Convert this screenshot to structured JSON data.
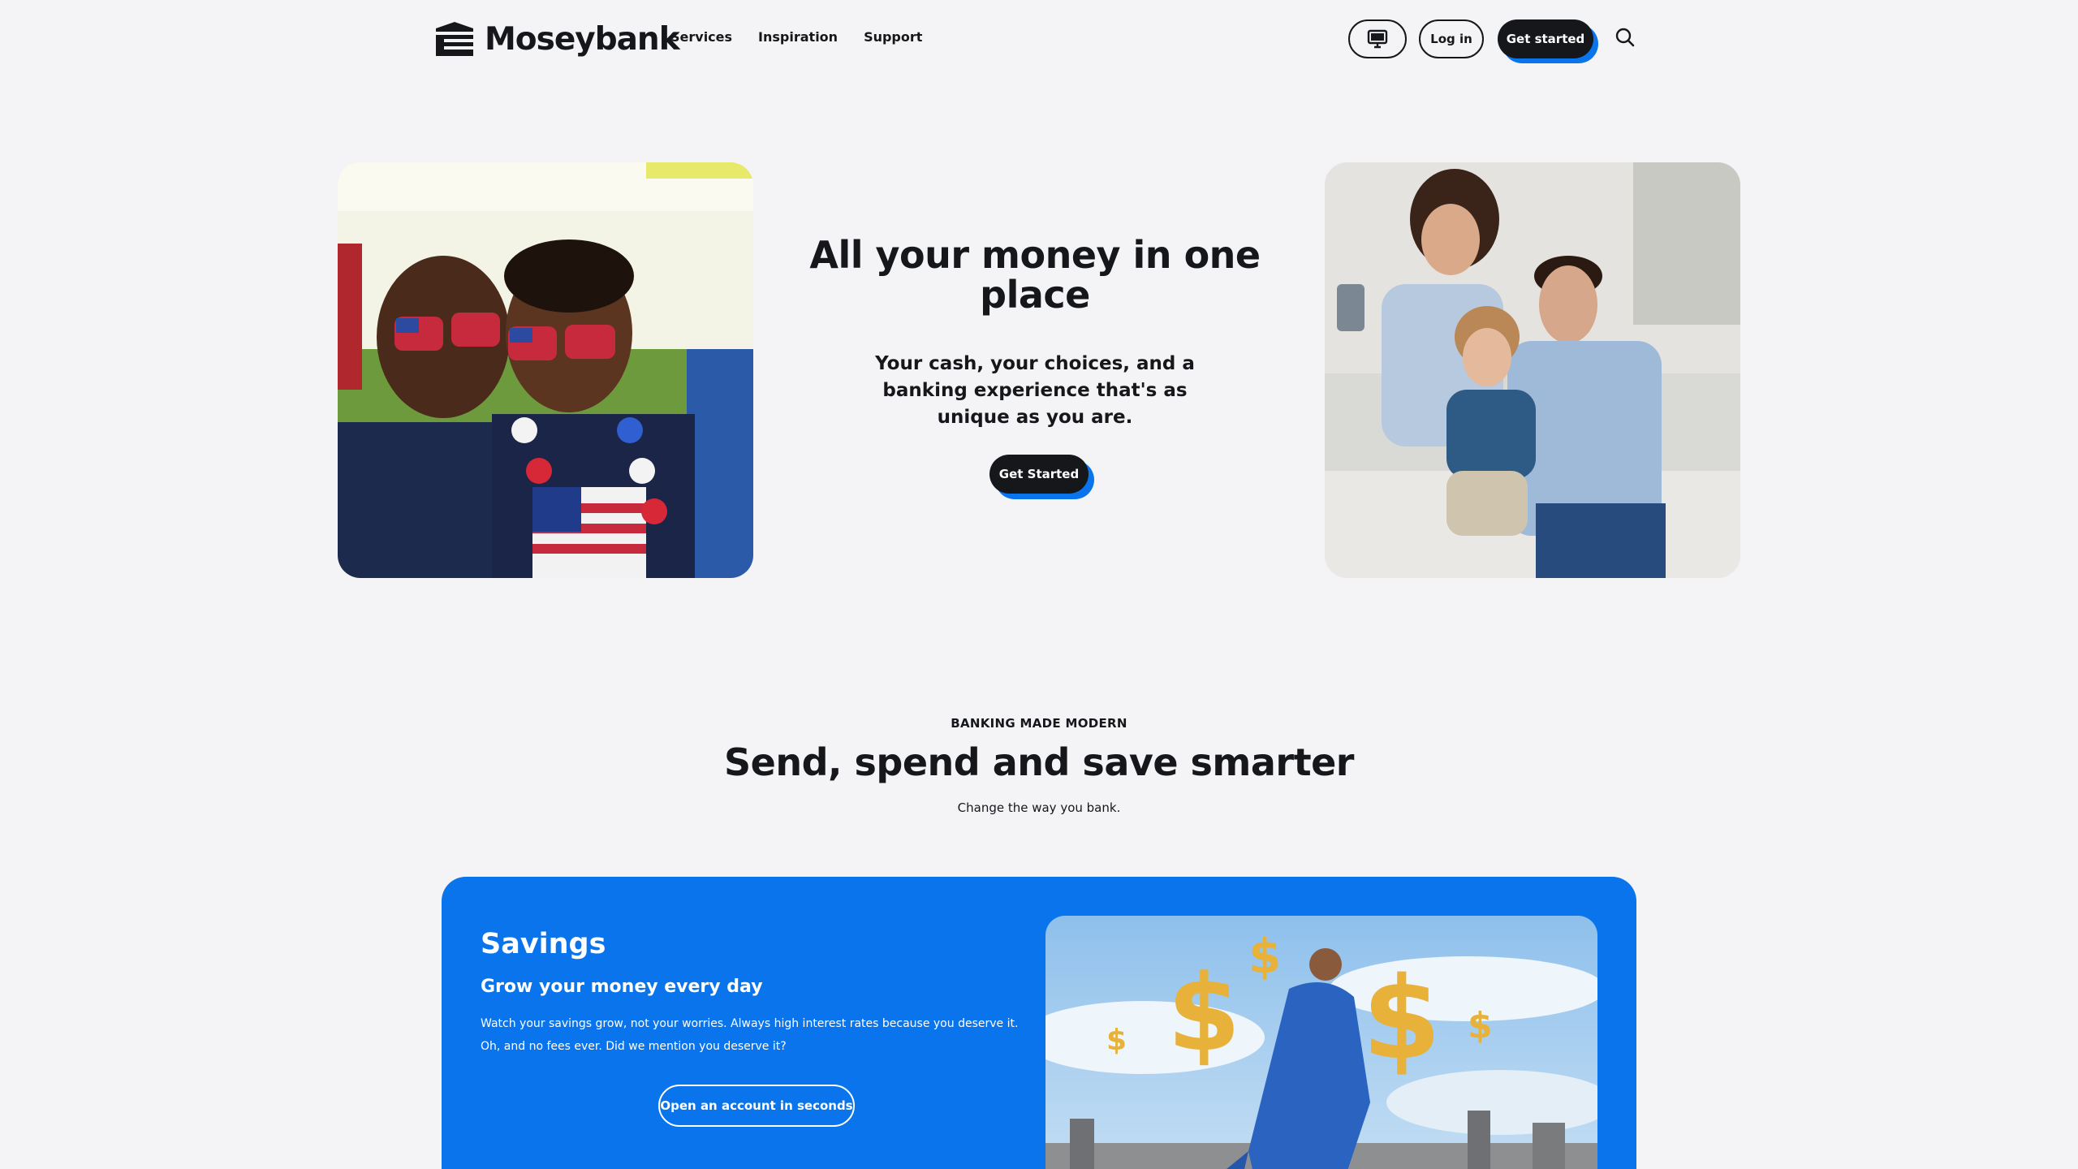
{
  "brand": {
    "name": "Moseybank",
    "accent": "#0a74ec",
    "dark": "#15171b",
    "background": "#f4f4f6"
  },
  "nav": {
    "items": [
      "Services",
      "Inspiration",
      "Support"
    ]
  },
  "header": {
    "theme_icon": "monitor-icon",
    "login_label": "Log in",
    "cta_label": "Get started",
    "search_icon": "search-icon"
  },
  "hero": {
    "title": "All your money in one place",
    "subtitle": "Your cash, your choices, and a banking experience that's as unique as you are.",
    "cta_label": "Get Started"
  },
  "section": {
    "eyebrow": "BANKING MADE MODERN",
    "title": "Send, spend and save smarter",
    "subtitle": "Change the way you bank."
  },
  "savings": {
    "title": "Savings",
    "subtitle": "Grow your money every day",
    "body": "Watch your savings grow, not your worries. Always high interest rates because you deserve it. Oh, and no fees ever. Did we mention you deserve it?",
    "cta_label": "Open an account in seconds"
  }
}
